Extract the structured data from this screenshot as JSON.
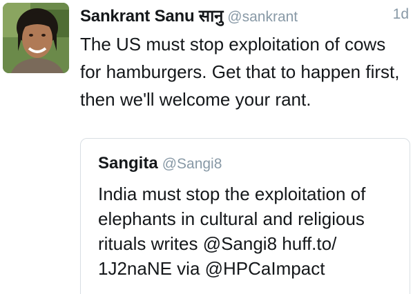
{
  "tweet": {
    "display_name": "Sankrant Sanu सानु",
    "handle": "@sankrant",
    "timestamp": "1d",
    "text": "The US must stop exploitation of cows for hamburgers. Get that to happen first, then we'll welcome your rant.",
    "avatar": "profile-photo"
  },
  "quoted_tweet": {
    "display_name": "Sangita",
    "handle": "@Sangi8",
    "text": "India must stop the exploitation of elephants in cultural and religious rituals writes @Sangi8 huff.to/ 1J2naNE via @HPCaImpact"
  },
  "colors": {
    "name_text": "#14171a",
    "secondary_text": "#8899a6",
    "card_border": "#d8dee3"
  }
}
